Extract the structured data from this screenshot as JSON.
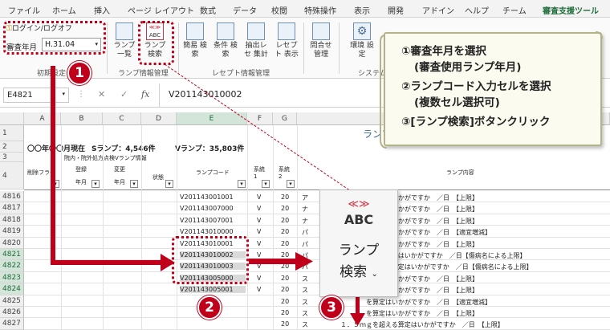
{
  "ribbon_tabs": [
    "ファイル",
    "ホーム",
    "挿入",
    "ページ レイアウト",
    "数式",
    "データ",
    "校閲",
    "特殊操作",
    "表示",
    "開発",
    "アドイン",
    "ヘルプ",
    "チーム",
    "審査支援ツール"
  ],
  "ribbon": {
    "login_label": "ログイン/ログオフ",
    "review_month_label": "審査年月",
    "review_month_value": "H.31.04",
    "buttons": {
      "lamp_list": "ランプ 一覧",
      "lamp_search": "ランプ 検索",
      "simple_search": "簡易 検索",
      "cond_search": "条件 検索",
      "extract_sum": "抽出レセ 集計",
      "rece_list": "レセプト 表示",
      "inquiry_mgmt": "問合せ 管理",
      "env_settings": "環境 設定"
    },
    "groups": {
      "initial": "初期設定",
      "lamp_info": "ランプ情報管理",
      "rece_info": "レセプト情報管理",
      "system": "システム"
    }
  },
  "formula_bar": {
    "name_box": "E4821",
    "fx": "fx",
    "value": "V201143010002"
  },
  "sheet": {
    "columns": [
      "A",
      "B",
      "C",
      "D",
      "E",
      "F",
      "G",
      "H"
    ],
    "header_rows": {
      "r2_date": "〇〇年〇〇月現在",
      "r2_s_lamp": "Sランプ：4,546件",
      "r2_v_lamp": "Vランプ：35,803件",
      "r1_title": "ランプ",
      "r3_group": "院内・院外処方点検Vランプ情報",
      "col_delete_flag": "削除フラグ",
      "col_register": "登録",
      "col_year_month": "年月",
      "col_change": "変更",
      "col_status": "状態",
      "col_lamp_code": "ランプコード",
      "col_system1": "系統 1",
      "col_system2": "系統 2",
      "col_lamp_content": "ランプ内容"
    },
    "rows": [
      {
        "num": "4816",
        "code": "V201143001001",
        "f": "V",
        "g": "20",
        "content": "ア　　　　　　　　　を算定はいかがですか　／日　【上限】"
      },
      {
        "num": "4817",
        "code": "V201143007000",
        "f": "V",
        "g": "20",
        "content": "ナ　　　　　　　　　を算定はいかがですか　／日　【上限】"
      },
      {
        "num": "4818",
        "code": "V201143007001",
        "f": "V",
        "g": "20",
        "content": "ナ　　　　　　　　　を算定はいかがですか　／日　【上限】"
      },
      {
        "num": "4819",
        "code": "V201143010000",
        "f": "V",
        "g": "20",
        "content": "パ　　　　　　　　　を算定はいかがですか　／日　【適宜増減】"
      },
      {
        "num": "4820",
        "code": "V201143010001",
        "f": "V",
        "g": "20",
        "content": "パ　　　　　　　　　を算定はいかがですか　／日　【上限】"
      },
      {
        "num": "4821",
        "code": "V201143010002",
        "f": "V",
        "g": "20",
        "content": "パ　　　　　０ｍｇを超える算定はいかがですか　／日【傷病名による上限】"
      },
      {
        "num": "4822",
        "code": "V201143010003",
        "f": "V",
        "g": "20",
        "content": "パ　　　　　４０ｍｇを超える算定はいかがですか　／日【傷病名による上限】"
      },
      {
        "num": "4823",
        "code": "V201143005000",
        "f": "V",
        "g": "20",
        "content": "ス　　　　　　　　　を算定はいかがですか　／日　【上限】"
      },
      {
        "num": "4824",
        "code": "V201143005001",
        "f": "V",
        "g": "20",
        "content": "ス　　　　　　　　　を算定はいかがですか　／日　【上限】"
      },
      {
        "num": "4825",
        "code": "",
        "f": "",
        "g": "20",
        "content": "ス　　　　　　　　　を算定はいかがですか　／日　【適宜増減】"
      },
      {
        "num": "4826",
        "code": "",
        "f": "",
        "g": "20",
        "content": "ス　　　　　　　　　を算定はいかがですか　／日　【上限】"
      },
      {
        "num": "4827",
        "code": "",
        "f": "",
        "g": "20",
        "content": "ス　　　　　１．５ｍｇを超える算定はいかがですか　／日　【上限】"
      }
    ]
  },
  "zoom_button": {
    "arrows": "≪≫",
    "abc": "ABC",
    "label_line1": "ランプ",
    "label_line2": "検索"
  },
  "note": {
    "line1": "①審査年月を選択",
    "line2": "(審査使用ランプ年月)",
    "line3": "②ランプコード入力セルを選択",
    "line4": "(複数セル選択可)",
    "line5": "③[ランプ検索]ボタンクリック"
  },
  "badges": [
    "1",
    "2",
    "3"
  ],
  "colors": {
    "annotation_red": "#c0001a",
    "excel_green": "#1e6b3a"
  }
}
